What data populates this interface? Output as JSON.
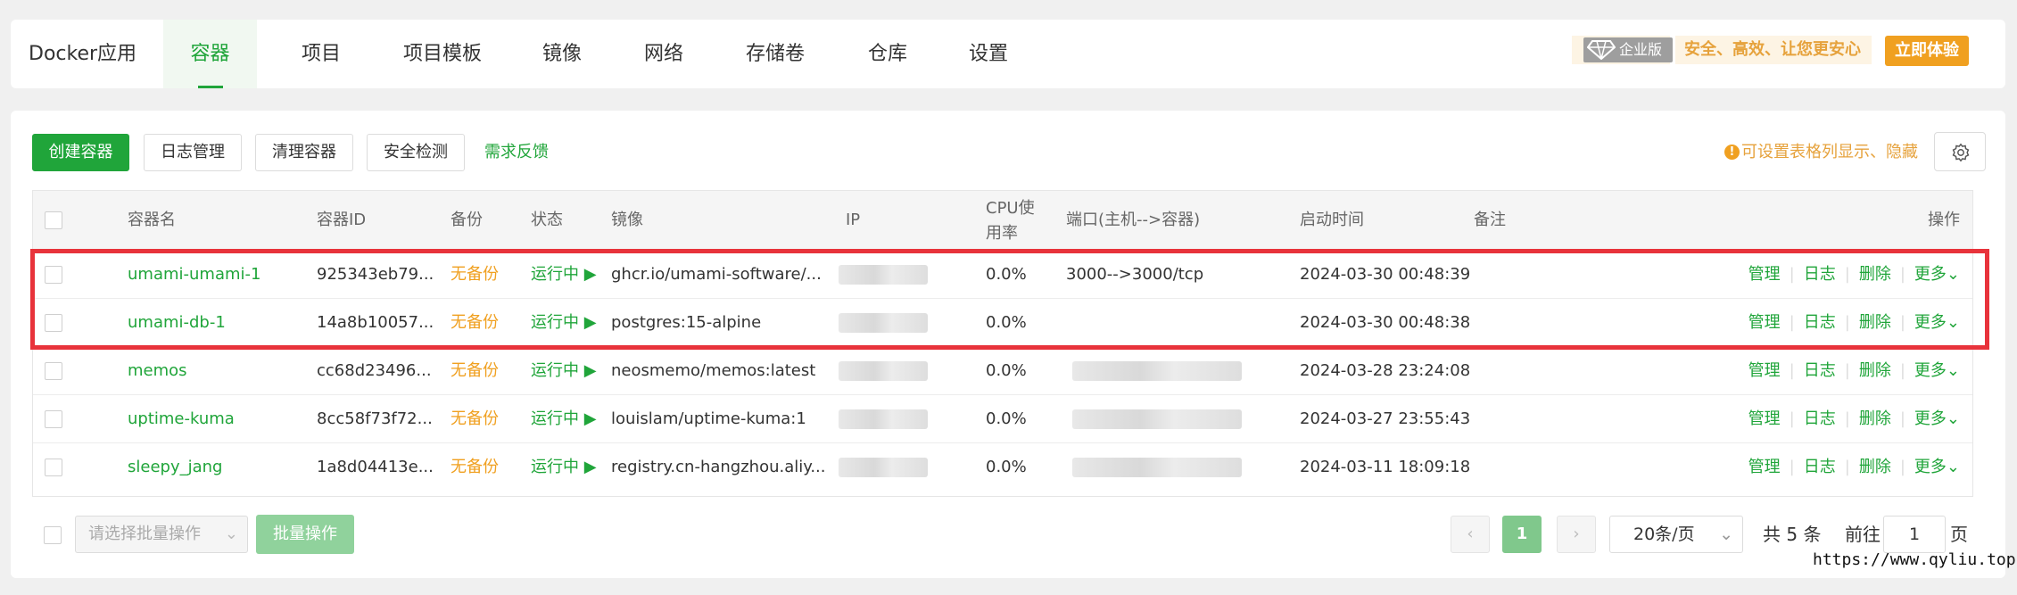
{
  "nav": {
    "brand": "Docker应用",
    "items": [
      "容器",
      "项目",
      "项目模板",
      "镜像",
      "网络",
      "存储卷",
      "仓库",
      "设置"
    ],
    "enterprise_badge": "企业版",
    "slogan": "安全、高效、让您更安心",
    "try_button": "立即体验"
  },
  "toolbar": {
    "create": "创建容器",
    "logs": "日志管理",
    "clean": "清理容器",
    "security": "安全检测",
    "feedback": "需求反馈",
    "tip": "可设置表格列显示、隐藏"
  },
  "table": {
    "headers": {
      "name": "容器名",
      "id": "容器ID",
      "backup": "备份",
      "status": "状态",
      "image": "镜像",
      "ip": "IP",
      "cpu_line1": "CPU使",
      "cpu_line2": "用率",
      "port": "端口(主机-->容器)",
      "start": "启动时间",
      "note": "备注",
      "ops": "操作"
    },
    "rows": [
      {
        "name": "umami-umami-1",
        "id": "925343eb79...",
        "backup": "无备份",
        "status": "运行中 ▶",
        "image": "ghcr.io/umami-software/...",
        "cpu": "0.0%",
        "port": "3000-->3000/tcp",
        "start": "2024-03-30 00:48:39"
      },
      {
        "name": "umami-db-1",
        "id": "14a8b10057...",
        "backup": "无备份",
        "status": "运行中 ▶",
        "image": "postgres:15-alpine",
        "cpu": "0.0%",
        "port": "",
        "start": "2024-03-30 00:48:38"
      },
      {
        "name": "memos",
        "id": "cc68d23496...",
        "backup": "无备份",
        "status": "运行中 ▶",
        "image": "neosmemo/memos:latest",
        "cpu": "0.0%",
        "port": "",
        "start": "2024-03-28 23:24:08"
      },
      {
        "name": "uptime-kuma",
        "id": "8cc58f73f72...",
        "backup": "无备份",
        "status": "运行中 ▶",
        "image": "louislam/uptime-kuma:1",
        "cpu": "0.0%",
        "port": "",
        "start": "2024-03-27 23:55:43"
      },
      {
        "name": "sleepy_jang",
        "id": "1a8d04413e...",
        "backup": "无备份",
        "status": "运行中 ▶",
        "image": "registry.cn-hangzhou.aliy...",
        "cpu": "0.0%",
        "port": "",
        "start": "2024-03-11 18:09:18"
      }
    ],
    "row_ops": {
      "manage": "管理",
      "log": "日志",
      "delete": "删除",
      "more": "更多"
    }
  },
  "footer": {
    "batch_placeholder": "请选择批量操作",
    "batch_button": "批量操作",
    "current_page": "1",
    "per_page": "20条/页",
    "total": "共 5 条",
    "goto": "前往",
    "goto_value": "1",
    "page_unit": "页"
  },
  "watermark": "https://www.qyliu.top",
  "colors": {
    "accent": "#20a53a",
    "warning": "#f0a020",
    "highlight": "#e8333b"
  }
}
